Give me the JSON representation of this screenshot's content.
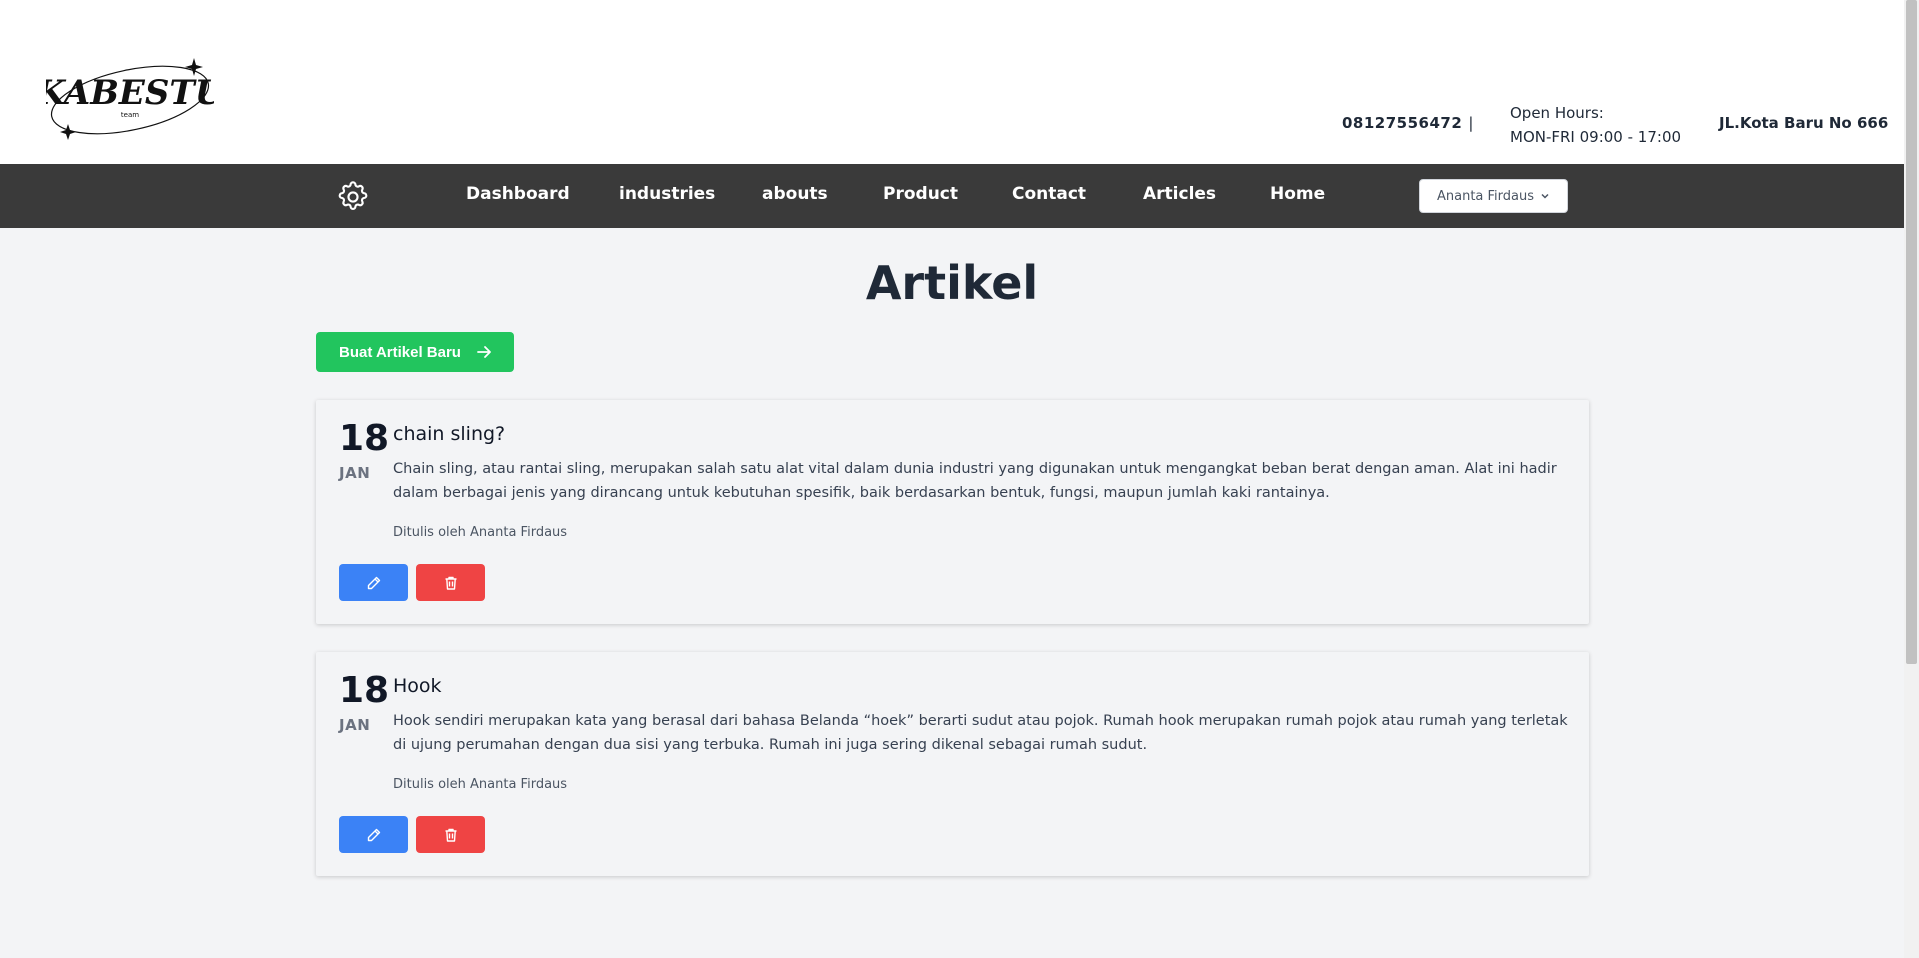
{
  "header": {
    "logo_text": "KABESTU",
    "logo_subtext": "team",
    "phone": "08127556472",
    "phone_separator": "|",
    "hours_label": "Open Hours:",
    "hours_value": "MON-FRI 09:00 - 17:00",
    "address": "JL.Kota Baru No 666"
  },
  "navbar": {
    "settings_icon": "gear-icon",
    "items": [
      {
        "label": "Dashboard"
      },
      {
        "label": "industries"
      },
      {
        "label": "abouts"
      },
      {
        "label": "Product"
      },
      {
        "label": "Contact"
      },
      {
        "label": "Articles"
      },
      {
        "label": "Home"
      }
    ],
    "user_dropdown": "Ananta Firdaus"
  },
  "main": {
    "title": "Artikel",
    "new_button_label": "Buat Artikel Baru",
    "articles": [
      {
        "day": "18",
        "month": "JAN",
        "title": "chain sling?",
        "excerpt": "Chain sling, atau rantai sling, merupakan salah satu alat vital dalam dunia industri yang digunakan untuk mengangkat beban berat dengan aman. Alat ini hadir dalam berbagai jenis yang dirancang untuk kebutuhan spesifik, baik berdasarkan bentuk, fungsi, maupun jumlah kaki rantainya.",
        "author": "Ditulis oleh Ananta Firdaus"
      },
      {
        "day": "18",
        "month": "JAN",
        "title": "Hook",
        "excerpt": "Hook sendiri merupakan kata yang berasal dari bahasa Belanda “hoek” berarti sudut atau pojok. Rumah hook merupakan rumah pojok atau rumah yang terletak di ujung perumahan dengan dua sisi yang terbuka. Rumah ini juga sering dikenal sebagai rumah sudut.",
        "author": "Ditulis oleh Ananta Firdaus"
      }
    ]
  },
  "colors": {
    "navbar_bg": "#3a3a3a",
    "new_button": "#22c55e",
    "edit_button": "#3b82f6",
    "delete_button": "#ef4444",
    "page_bg": "#f3f4f6"
  }
}
